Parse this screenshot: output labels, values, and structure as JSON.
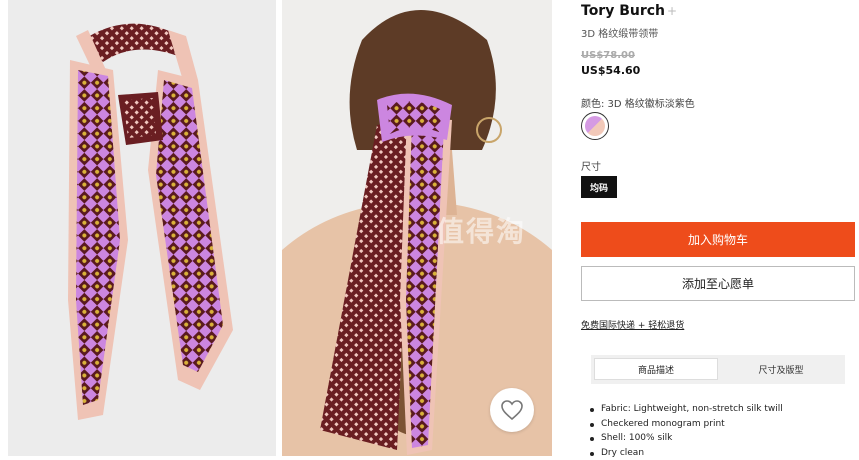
{
  "product": {
    "brand": "Tory Burch",
    "brand_plus": "+",
    "subtitle": "3D 格纹缎带领带",
    "price_original": "US$78.00",
    "price_sale": "US$54.60"
  },
  "color": {
    "label": "颜色: 3D 格纹徽标淡紫色",
    "swatch_colors": [
      "#d59ae3",
      "#f2c9b9"
    ]
  },
  "size": {
    "label": "尺寸",
    "selected": "均码"
  },
  "actions": {
    "add_to_cart": "加入购物车",
    "add_to_wishlist": "添加至心愿单",
    "shipping_link": "免费国际快递 + 轻松退货"
  },
  "tabs": [
    {
      "label": "商品描述",
      "active": true
    },
    {
      "label": "尺寸及版型",
      "active": false
    }
  ],
  "description": [
    "Fabric: Lightweight, non-stretch silk twill",
    "Checkered monogram print",
    "Shell: 100% silk",
    "Dry clean"
  ],
  "watermark": "值得淘",
  "icons": {
    "favorite": "heart-icon"
  },
  "colors": {
    "accent": "#ee4c1b",
    "burgundy": "#6a1e22",
    "lilac": "#cc86e0",
    "blush": "#efc3b5"
  }
}
